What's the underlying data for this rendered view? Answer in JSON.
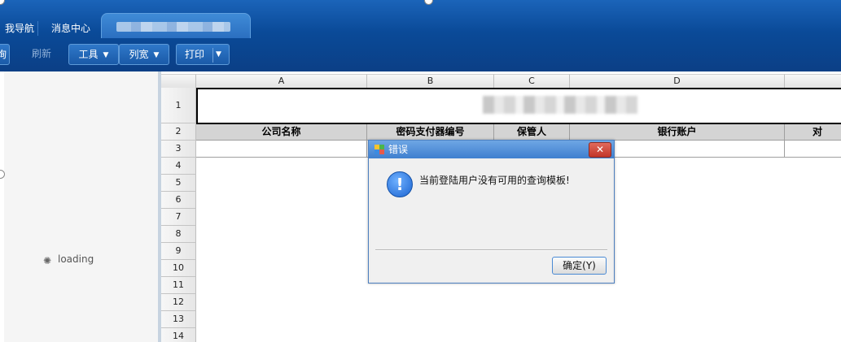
{
  "tabs": [
    {
      "label": "我导航",
      "active": false
    },
    {
      "label": "消息中心",
      "active": false
    },
    {
      "label": "",
      "active": true
    }
  ],
  "toolbar": {
    "first_partial": "询",
    "refresh": "刷新",
    "tools": "工具",
    "column_width": "列宽",
    "print": "打印"
  },
  "left_panel": {
    "loading_text": "loading"
  },
  "sheet": {
    "columns": [
      "A",
      "B",
      "C",
      "D"
    ],
    "rows": [
      "1",
      "2",
      "3",
      "4",
      "5",
      "6",
      "7",
      "8",
      "9",
      "10",
      "11",
      "12",
      "13",
      "14"
    ],
    "headers": [
      "公司名称",
      "密码支付器编号",
      "保管人",
      "银行账户",
      "对"
    ]
  },
  "dialog": {
    "title": "错误",
    "close": "✕",
    "message": "当前登陆用户没有可用的查询模板!",
    "ok_button": "确定(Y)",
    "info_icon": "!"
  },
  "colors": {
    "chrome_blue": "#0b4a98",
    "dialog_title": "#4f8fd8",
    "header_fill": "#d4d4d4"
  }
}
